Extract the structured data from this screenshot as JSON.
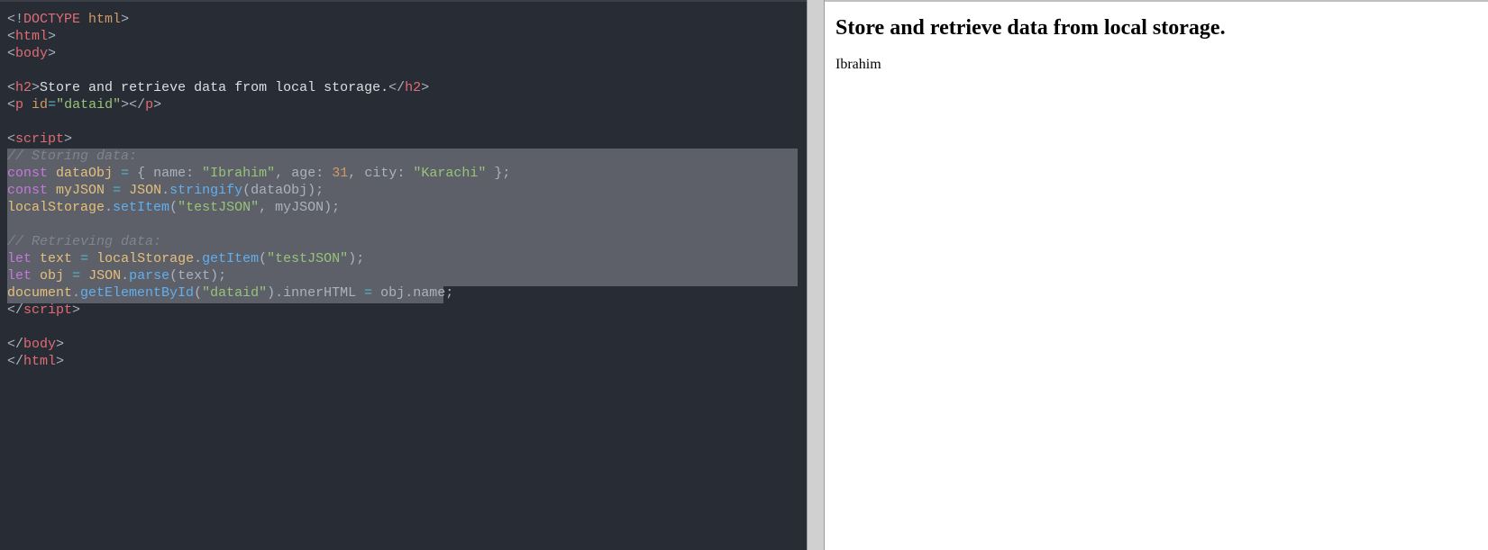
{
  "editor": {
    "line01_doctype": "<!DOCTYPE html>",
    "line02_open_html": "html",
    "line03_open_body": "body",
    "line05_h2_text": "Store and retrieve data from local storage.",
    "line06_p_attr_name": "id",
    "line06_p_attr_val": "\"dataid\"",
    "line08_script_tag": "script",
    "line09_comment": "// Storing data:",
    "line10_const": "const",
    "line10_var": "dataObj",
    "line10_eq": "=",
    "line10_brace_open": "{",
    "line10_k_name": "name",
    "line10_v_name": "\"Ibrahim\"",
    "line10_k_age": "age",
    "line10_v_age": "31",
    "line10_k_city": "city",
    "line10_v_city": "\"Karachi\"",
    "line10_brace_close": "};",
    "line11_const": "const",
    "line11_var": "myJSON",
    "line11_rhs_obj": "JSON",
    "line11_rhs_fn": "stringify",
    "line11_rhs_arg": "dataObj",
    "line12_obj": "localStorage",
    "line12_fn": "setItem",
    "line12_arg1": "\"testJSON\"",
    "line12_arg2": "myJSON",
    "line14_comment": "// Retrieving data:",
    "line15_let": "let",
    "line15_var": "text",
    "line15_obj": "localStorage",
    "line15_fn": "getItem",
    "line15_arg": "\"testJSON\"",
    "line16_let": "let",
    "line16_var": "obj",
    "line16_obj": "JSON",
    "line16_fn": "parse",
    "line16_arg": "text",
    "line17_obj": "document",
    "line17_fn": "getElementById",
    "line17_arg": "\"dataid\"",
    "line17_prop": "innerHTML",
    "line17_rhs_obj": "obj",
    "line17_rhs_prop": "name",
    "line18_close_script": "script",
    "line20_close_body": "body",
    "line21_close_html": "html",
    "selection_start_line": 9,
    "selection_end_line": 17
  },
  "output": {
    "heading": "Store and retrieve data from local storage.",
    "result": "Ibrahim"
  }
}
